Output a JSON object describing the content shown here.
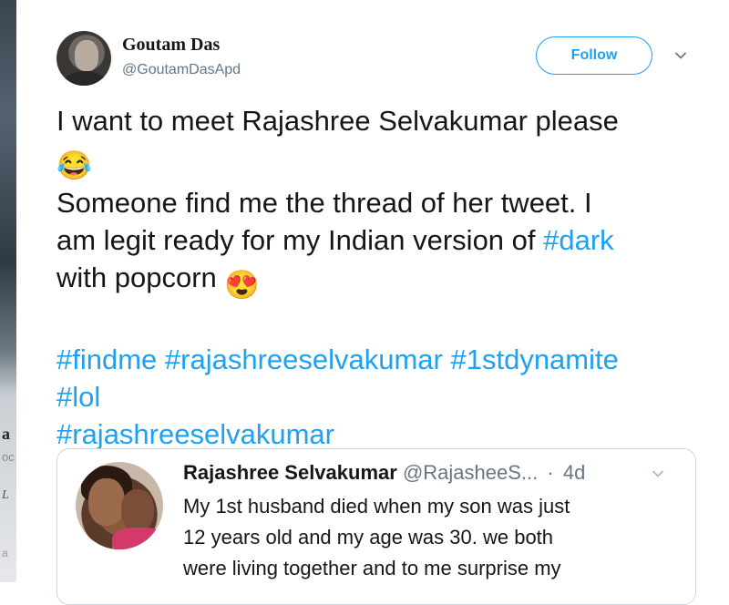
{
  "background_edge": {
    "glyph_a": "a",
    "glyph_b": "oc",
    "glyph_c": "L",
    "glyph_d": "a"
  },
  "tweet": {
    "author_name": "Goutam Das",
    "author_handle": "@GoutamDasApd",
    "follow_label": "Follow",
    "text": {
      "line1": "I want to meet Rajashree Selvakumar please",
      "line2_emoji": "😂",
      "line3": "Someone find me the thread of her tweet. I",
      "line4_pre": "am legit ready for my Indian version of ",
      "line4_tag": "#dark",
      "line5_pre": "with popcorn ",
      "line5_emoji": "😍",
      "hashtags_line1": "#findme #rajashreeselvakumar #1stdynamite",
      "hashtags_line2": "#lol",
      "hashtags_line3": "#rajashreeselvakumar"
    }
  },
  "quoted_tweet": {
    "author_name": "Rajashree Selvakumar",
    "author_handle": "@RajasheeS...",
    "time_sep": "·",
    "time": "4d",
    "text_lines": [
      "My 1st husband died when my son was just",
      "12 years old and my age was 30. we both",
      "were living together and to me surprise my"
    ]
  },
  "colors": {
    "accent": "#1da1f2",
    "text": "#14171a",
    "secondary": "#657786",
    "border": "#ccd6dd"
  },
  "icons": {
    "caret": "chevron-down-icon"
  }
}
